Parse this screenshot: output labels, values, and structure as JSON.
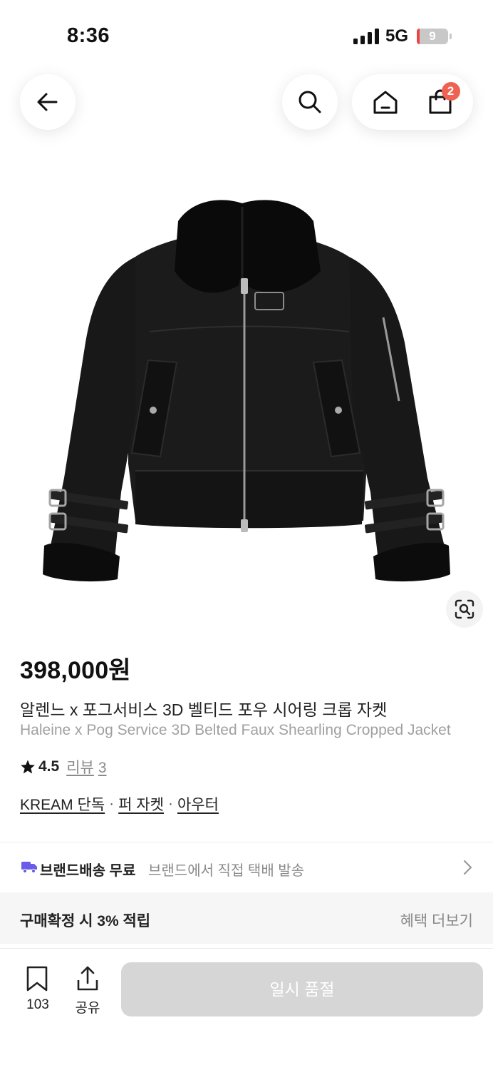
{
  "status_bar": {
    "time": "8:36",
    "network": "5G",
    "battery": "9",
    "battery_level": 0.09
  },
  "nav": {
    "cart_count": "2",
    "icons": [
      "arrow-left-icon",
      "search-icon",
      "home-icon",
      "shopping-bag-icon"
    ]
  },
  "product": {
    "price": "398,000원",
    "name_ko": "알렌느 x 포그서비스 3D 벨티드 포우 시어링 크롭 자켓",
    "name_en": "Haleine x Pog Service 3D Belted Faux Shearling Cropped Jacket",
    "rating": "4.5",
    "review_label": "리뷰",
    "review_count": "3",
    "tags": [
      "KREAM 단독",
      "퍼 자켓",
      "아우터"
    ],
    "tag_separator": "·"
  },
  "shipping": {
    "title": "브랜드배송 무료",
    "desc": "브랜드에서 직접 택배 발송",
    "icon": "truck-icon"
  },
  "benefit": {
    "title": "구매확정 시 3% 적립",
    "more": "혜택 더보기"
  },
  "bottom_bar": {
    "bookmark_count": "103",
    "share_label": "공유",
    "buy_button": "일시 품절"
  },
  "colors": {
    "badge": "#ef6253",
    "shipping_icon": "#6b5ce7",
    "disabled_button": "#d6d6d6"
  }
}
